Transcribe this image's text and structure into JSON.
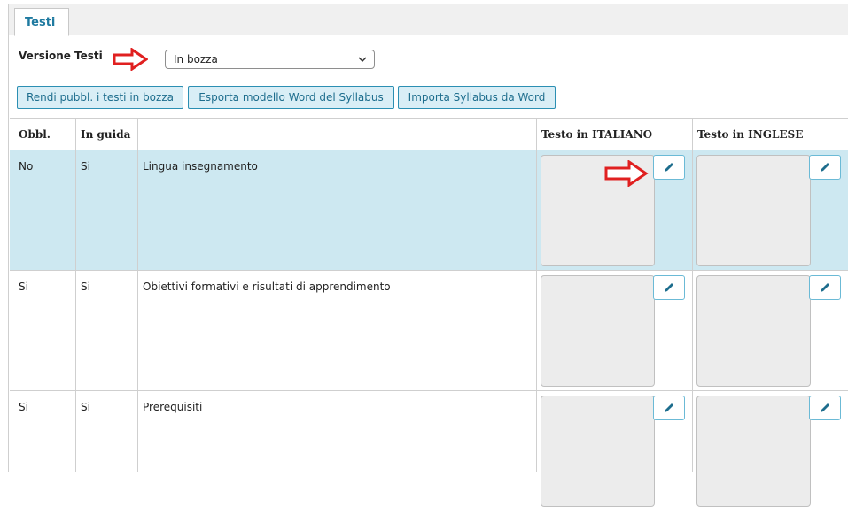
{
  "tabs": [
    {
      "label": "Testi"
    }
  ],
  "version": {
    "label": "Versione Testi",
    "selected": "In bozza"
  },
  "buttons": {
    "publish": "Rendi pubbl. i testi in bozza",
    "export": "Esporta modello Word del Syllabus",
    "import": "Importa Syllabus da Word"
  },
  "table": {
    "headers": {
      "obbl": "Obbl.",
      "guida": "In guida",
      "desc": "",
      "ita": "Testo in ITALIANO",
      "eng": "Testo in INGLESE"
    },
    "rows": [
      {
        "obbl": "No",
        "guida": "Si",
        "desc": "Lingua insegnamento",
        "selected": true
      },
      {
        "obbl": "Si",
        "guida": "Si",
        "desc": "Obiettivi formativi e risultati di apprendimento",
        "selected": false
      },
      {
        "obbl": "Si",
        "guida": "Si",
        "desc": "Prerequisiti",
        "selected": false
      }
    ]
  },
  "icons": {
    "edit": "pencil-icon",
    "dropdown": "chevron-down-icon",
    "annotation": "red-outline-arrow-icon"
  },
  "colors": {
    "accent": "#1f7aa0",
    "selected_row": "#cde8f1",
    "button_bg": "#d9eef6",
    "annotation": "#e02020"
  }
}
